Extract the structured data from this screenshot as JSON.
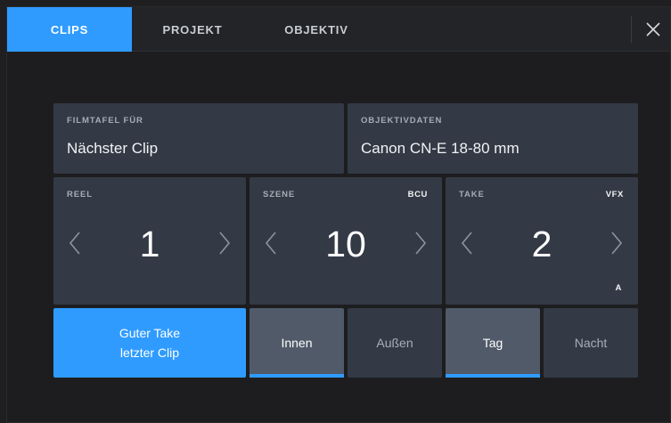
{
  "tabs": [
    {
      "label": "CLIPS",
      "active": true
    },
    {
      "label": "PROJEKT",
      "active": false
    },
    {
      "label": "OBJEKTIV",
      "active": false
    }
  ],
  "close_icon": "close-icon",
  "filmtafel": {
    "label": "FILMTAFEL FÜR",
    "value": "Nächster Clip"
  },
  "objektivdaten": {
    "label": "OBJEKTIVDATEN",
    "value": "Canon CN-E 18-80 mm"
  },
  "reel": {
    "label": "REEL",
    "value": "1"
  },
  "szene": {
    "label": "SZENE",
    "value": "10",
    "tag": "BCU"
  },
  "take": {
    "label": "TAKE",
    "value": "2",
    "tag_top": "VFX",
    "tag_bottom": "A"
  },
  "buttons": {
    "guter_take_line1": "Guter Take",
    "guter_take_line2": "letzter Clip",
    "innen": "Innen",
    "aussen": "Außen",
    "tag": "Tag",
    "nacht": "Nacht"
  },
  "selected": {
    "innen_aussen": "Innen",
    "tag_nacht": "Tag"
  },
  "colors": {
    "accent": "#2f9bff",
    "panel": "#333a45",
    "selected": "#505a69",
    "background": "#1d1d1f"
  }
}
